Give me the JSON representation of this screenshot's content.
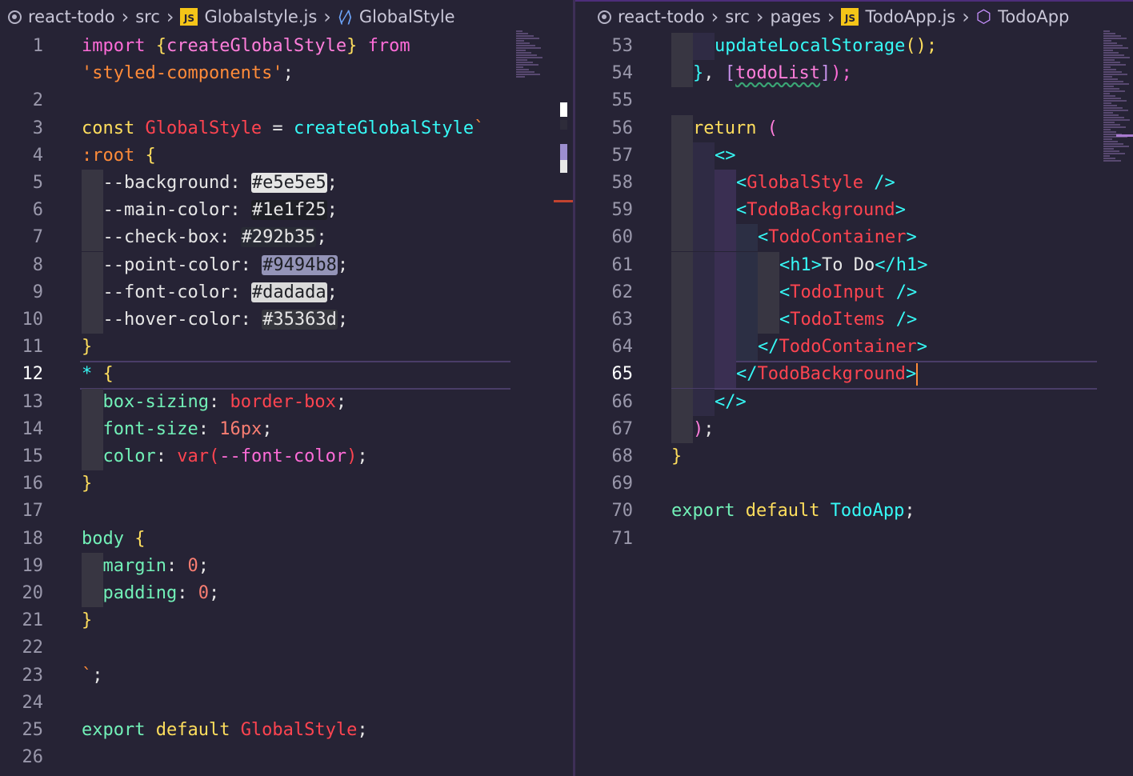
{
  "left_editor": {
    "breadcrumb": {
      "project": "react-todo",
      "folder": "src",
      "file": "Globalstyle.js",
      "symbol": "GlobalStyle"
    },
    "active_line": "12",
    "lines": [
      {
        "n": "1",
        "tokens": [
          [
            "import ",
            "kw2"
          ],
          [
            "{",
            "brace"
          ],
          [
            "createGlobalStyle",
            "var"
          ],
          [
            "}",
            "brace"
          ],
          [
            " from",
            "kw2"
          ]
        ]
      },
      {
        "n": "",
        "tokens": [
          [
            "'styled-components'",
            "str"
          ],
          [
            ";",
            "plain"
          ]
        ]
      },
      {
        "n": "2",
        "tokens": []
      },
      {
        "n": "3",
        "tokens": [
          [
            "const ",
            "kw"
          ],
          [
            "GlobalStyle",
            "red"
          ],
          [
            " = ",
            "plain"
          ],
          [
            "createGlobalStyle",
            "cyan"
          ],
          [
            "`",
            "str"
          ]
        ]
      },
      {
        "n": "4",
        "tokens": [
          [
            ":root",
            "str"
          ],
          [
            " {",
            "brace"
          ]
        ]
      },
      {
        "n": "5",
        "indent": 1,
        "tokens": [
          [
            "  --background: ",
            "plain"
          ],
          [
            "#e5e5e5",
            "sw sw1"
          ],
          [
            ";",
            "plain"
          ]
        ]
      },
      {
        "n": "6",
        "indent": 1,
        "tokens": [
          [
            "  --main-color: ",
            "plain"
          ],
          [
            "#1e1f25",
            "sw sw2"
          ],
          [
            ";",
            "plain"
          ]
        ]
      },
      {
        "n": "7",
        "indent": 1,
        "tokens": [
          [
            "  --check-box: ",
            "plain"
          ],
          [
            "#292b35",
            "sw sw3"
          ],
          [
            ";",
            "plain"
          ]
        ]
      },
      {
        "n": "8",
        "indent": 1,
        "tokens": [
          [
            "  --point-color: ",
            "plain"
          ],
          [
            "#9494b8",
            "sw sw4"
          ],
          [
            ";",
            "plain"
          ]
        ]
      },
      {
        "n": "9",
        "indent": 1,
        "tokens": [
          [
            "  --font-color: ",
            "plain"
          ],
          [
            "#dadada",
            "sw sw5"
          ],
          [
            ";",
            "plain"
          ]
        ]
      },
      {
        "n": "10",
        "indent": 1,
        "tokens": [
          [
            "  --hover-color: ",
            "plain"
          ],
          [
            "#35363d",
            "sw sw6"
          ],
          [
            ";",
            "plain"
          ]
        ]
      },
      {
        "n": "11",
        "tokens": [
          [
            "}",
            "brace"
          ]
        ]
      },
      {
        "n": "12",
        "current": true,
        "tokens": [
          [
            "*",
            "fn"
          ],
          [
            " {",
            "brace"
          ]
        ]
      },
      {
        "n": "13",
        "indent": 1,
        "tokens": [
          [
            "  box-sizing",
            "prop"
          ],
          [
            ": ",
            "plain"
          ],
          [
            "border-box",
            "red"
          ],
          [
            ";",
            "plain"
          ]
        ]
      },
      {
        "n": "14",
        "indent": 1,
        "tokens": [
          [
            "  font-size",
            "prop"
          ],
          [
            ": ",
            "plain"
          ],
          [
            "16px",
            "num"
          ],
          [
            ";",
            "plain"
          ]
        ]
      },
      {
        "n": "15",
        "indent": 1,
        "tokens": [
          [
            "  color",
            "prop"
          ],
          [
            ": ",
            "plain"
          ],
          [
            "var",
            "red"
          ],
          [
            "(",
            "red"
          ],
          [
            "--font-color",
            "kw2"
          ],
          [
            ")",
            "red"
          ],
          [
            ";",
            "plain"
          ]
        ]
      },
      {
        "n": "16",
        "tokens": [
          [
            "}",
            "brace"
          ]
        ]
      },
      {
        "n": "17",
        "tokens": []
      },
      {
        "n": "18",
        "tokens": [
          [
            "body",
            "sel"
          ],
          [
            " {",
            "brace"
          ]
        ]
      },
      {
        "n": "19",
        "indent": 1,
        "tokens": [
          [
            "  margin",
            "prop"
          ],
          [
            ": ",
            "plain"
          ],
          [
            "0",
            "num"
          ],
          [
            ";",
            "plain"
          ]
        ]
      },
      {
        "n": "20",
        "indent": 1,
        "tokens": [
          [
            "  padding",
            "prop"
          ],
          [
            ": ",
            "plain"
          ],
          [
            "0",
            "num"
          ],
          [
            ";",
            "plain"
          ]
        ]
      },
      {
        "n": "21",
        "tokens": [
          [
            "}",
            "brace"
          ]
        ]
      },
      {
        "n": "22",
        "tokens": []
      },
      {
        "n": "23",
        "tokens": [
          [
            "`",
            "str"
          ],
          [
            ";",
            "plain"
          ]
        ]
      },
      {
        "n": "24",
        "tokens": []
      },
      {
        "n": "25",
        "tokens": [
          [
            "export ",
            "prop"
          ],
          [
            "default ",
            "kw"
          ],
          [
            "GlobalStyle",
            "red"
          ],
          [
            ";",
            "plain"
          ]
        ]
      },
      {
        "n": "26",
        "tokens": []
      }
    ]
  },
  "right_editor": {
    "breadcrumb": {
      "project": "react-todo",
      "folder1": "src",
      "folder2": "pages",
      "file": "TodoApp.js",
      "symbol": "TodoApp"
    },
    "active_line": "65",
    "lines": [
      {
        "n": "53",
        "indent": 2,
        "tokens": [
          [
            "updateLocalStorage",
            "cyan"
          ],
          [
            "();",
            "kw"
          ]
        ]
      },
      {
        "n": "54",
        "indent": 1,
        "tokens": [
          [
            "}",
            "fn"
          ],
          [
            ", ",
            "plain"
          ],
          [
            "[",
            "purp"
          ],
          [
            "todoList",
            "var squig"
          ],
          [
            "]",
            "purp"
          ],
          [
            ");",
            "kw2"
          ]
        ]
      },
      {
        "n": "55",
        "tokens": []
      },
      {
        "n": "56",
        "indent": 1,
        "tokens": [
          [
            "return ",
            "kw"
          ],
          [
            "(",
            "var"
          ]
        ]
      },
      {
        "n": "57",
        "indent": 2,
        "tokens": [
          [
            "<>",
            "cyan"
          ]
        ]
      },
      {
        "n": "58",
        "indent": 3,
        "tokens": [
          [
            "<",
            "cyan"
          ],
          [
            "GlobalStyle",
            "tag"
          ],
          [
            " />",
            "cyan"
          ]
        ]
      },
      {
        "n": "59",
        "indent": 3,
        "tokens": [
          [
            "<",
            "cyan"
          ],
          [
            "TodoBackground",
            "tag"
          ],
          [
            ">",
            "cyan"
          ]
        ]
      },
      {
        "n": "60",
        "indent": 4,
        "tokens": [
          [
            "<",
            "cyan"
          ],
          [
            "TodoContainer",
            "tag"
          ],
          [
            ">",
            "cyan"
          ]
        ]
      },
      {
        "n": "61",
        "indent": 5,
        "tokens": [
          [
            "<h1>",
            "cyan"
          ],
          [
            "To Do",
            "plain"
          ],
          [
            "</h1>",
            "cyan"
          ]
        ]
      },
      {
        "n": "62",
        "indent": 5,
        "tokens": [
          [
            "<",
            "cyan"
          ],
          [
            "TodoInput",
            "tag"
          ],
          [
            " />",
            "cyan"
          ]
        ]
      },
      {
        "n": "63",
        "indent": 5,
        "tokens": [
          [
            "<",
            "cyan"
          ],
          [
            "TodoItems",
            "tag"
          ],
          [
            " />",
            "cyan"
          ]
        ]
      },
      {
        "n": "64",
        "indent": 4,
        "tokens": [
          [
            "</",
            "cyan"
          ],
          [
            "TodoContainer",
            "tag"
          ],
          [
            ">",
            "cyan"
          ]
        ]
      },
      {
        "n": "65",
        "indent": 3,
        "current": true,
        "cursor": true,
        "tokens": [
          [
            "</",
            "cyan"
          ],
          [
            "TodoBackground",
            "tag"
          ],
          [
            ">",
            "cyan"
          ]
        ]
      },
      {
        "n": "66",
        "indent": 2,
        "tokens": [
          [
            "</>",
            "cyan"
          ]
        ]
      },
      {
        "n": "67",
        "indent": 1,
        "tokens": [
          [
            ")",
            "var"
          ],
          [
            ";",
            "plain"
          ]
        ]
      },
      {
        "n": "68",
        "tokens": [
          [
            "}",
            "brace"
          ]
        ]
      },
      {
        "n": "69",
        "tokens": []
      },
      {
        "n": "70",
        "tokens": [
          [
            "export ",
            "prop"
          ],
          [
            "default ",
            "kw"
          ],
          [
            "TodoApp",
            "fn"
          ],
          [
            ";",
            "plain"
          ]
        ]
      },
      {
        "n": "71",
        "tokens": []
      }
    ]
  },
  "colors": {
    "background": "#262335",
    "keyword": "#fede5d",
    "tag": "#fe4450",
    "cyan": "#36f9f6"
  }
}
